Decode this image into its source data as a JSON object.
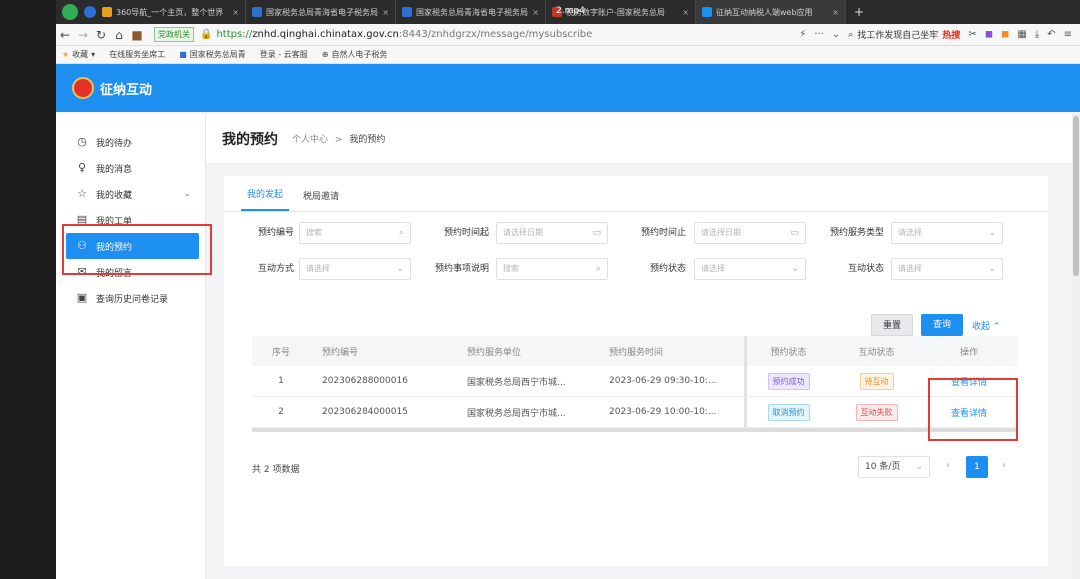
{
  "video": {
    "title": "2.mp4"
  },
  "browser": {
    "tabs": [
      {
        "label": "360导航_一个主页，整个世界"
      },
      {
        "label": "国家税务总局青海省电子税务局"
      },
      {
        "label": "国家税务总局青海省电子税务局"
      },
      {
        "label": "税务数字账户-国家税务总局"
      },
      {
        "label": "征纳互动纳税人端web应用"
      }
    ],
    "url": {
      "badge": "党政机关",
      "scheme": "https://",
      "host": "znhd.qinghai.chinatax.gov.cn",
      "rest": ":8443/znhdgrzx/message/mysubscribe"
    },
    "search_hint": "找工作发现自己坐牢",
    "hot": "热搜",
    "bookmarks": [
      {
        "label": "收藏"
      },
      {
        "label": "在线服务坐席工"
      },
      {
        "label": "国家税务总局青"
      },
      {
        "label": "登录 - 云客服"
      },
      {
        "label": "自然人电子税务"
      }
    ]
  },
  "app": {
    "title": "征纳互动"
  },
  "sidebar": {
    "items": [
      {
        "label": "我的待办"
      },
      {
        "label": "我的消息"
      },
      {
        "label": "我的收藏"
      },
      {
        "label": "我的工单"
      },
      {
        "label": "我的预约"
      },
      {
        "label": "我的留言"
      },
      {
        "label": "查询历史问卷记录"
      }
    ]
  },
  "page": {
    "title": "我的预约",
    "breadcrumb": {
      "parent": "个人中心",
      "sep": ">",
      "current": "我的预约"
    },
    "tabs": [
      "我的发起",
      "税局邀请"
    ]
  },
  "form": {
    "fields": [
      {
        "label": "预约编号",
        "placeholder": "搜索"
      },
      {
        "label": "预约时间起",
        "placeholder": "请选择日期"
      },
      {
        "label": "预约时间止",
        "placeholder": "请选择日期"
      },
      {
        "label": "预约服务类型",
        "placeholder": "请选择"
      },
      {
        "label": "互动方式",
        "placeholder": "请选择"
      },
      {
        "label": "预约事项说明",
        "placeholder": "搜索"
      },
      {
        "label": "预约状态",
        "placeholder": "请选择"
      },
      {
        "label": "互动状态",
        "placeholder": "请选择"
      }
    ],
    "reset_label": "重置",
    "query_label": "查询",
    "collapse_label": "收起"
  },
  "table": {
    "headers": [
      "序号",
      "预约编号",
      "预约服务单位",
      "预约服务时间",
      "预约状态",
      "互动状态",
      "操作"
    ],
    "rows": [
      {
        "index": "1",
        "code": "202306288000016",
        "unit": "国家税务总局西宁市城...",
        "time": "2023-06-29 09:30-10:...",
        "status": "预约成功",
        "interact": "待互动",
        "action": "查看详情"
      },
      {
        "index": "2",
        "code": "202306284000015",
        "unit": "国家税务总局西宁市城...",
        "time": "2023-06-29 10:00-10:...",
        "status": "取消预约",
        "interact": "互动失败",
        "action": "查看详情"
      }
    ]
  },
  "pagination": {
    "total": "共 2 项数据",
    "page_size": "10 条/页",
    "current": "1"
  }
}
